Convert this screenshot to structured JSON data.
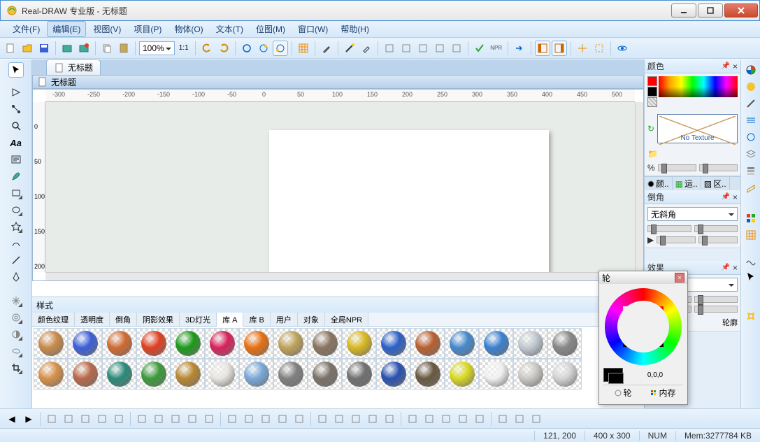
{
  "title": "Real-DRAW 专业版 - 无标题",
  "menus": [
    "文件(F)",
    "编辑(E)",
    "视图(V)",
    "项目(P)",
    "物体(O)",
    "文本(T)",
    "位图(M)",
    "窗口(W)",
    "帮助(H)"
  ],
  "active_menu_index": 1,
  "toolbar": {
    "zoom": "100%",
    "ratio": "1:1"
  },
  "doc_tab": "无标题",
  "doc_header": "无标题",
  "ruler_h": [
    "-300",
    "-250",
    "-200",
    "-150",
    "-100",
    "-50",
    "0",
    "50",
    "100",
    "150",
    "200",
    "250",
    "300",
    "350",
    "400",
    "450",
    "500"
  ],
  "ruler_v": [
    "0",
    "50",
    "100",
    "150",
    "200"
  ],
  "right": {
    "color_title": "颜色",
    "no_texture": "No Texture",
    "percent": "%",
    "tabs": [
      "颜..",
      "运..",
      "区.."
    ],
    "bevel_title": "倒角",
    "bevel_value": "无斜角",
    "effect_title": "效果",
    "outline_title": "轮廓"
  },
  "style_panel": {
    "title": "样式",
    "tabs": [
      "颜色纹理",
      "透明度",
      "倒角",
      "阴影效果",
      "3D灯光",
      "库 A",
      "库 B",
      "用户",
      "对象",
      "全局NPR"
    ],
    "active_tab_index": 5
  },
  "float": {
    "title": "轮",
    "value": "0,0,0",
    "tab1": "轮",
    "tab2": "内存"
  },
  "status": {
    "pos": "121, 200",
    "size": "400 x 300",
    "num": "NUM",
    "mem": "Mem:3277784 KB"
  },
  "balls": [
    [
      "#c98a4a",
      "#3a5fd8",
      "#d06a30",
      "#e04020",
      "#1a9a1a",
      "#d8205a",
      "#e87010",
      "#bfa35a",
      "#8a7460",
      "#d8b820",
      "#2a60c8",
      "#b86030",
      "#4488cc",
      "#3a80d0",
      "#c0c8d0",
      "#888"
    ],
    [
      "#d89048",
      "#b86848",
      "#2a8a7a",
      "#3a9a3a",
      "#b88830",
      "#e8e4e0",
      "#7aa8d8",
      "#808080",
      "#7a7268",
      "#707070",
      "#2850b0",
      "#685840",
      "#d8d820",
      "#f0f0f0",
      "#cac8c4",
      "#d4d4d4"
    ]
  ]
}
